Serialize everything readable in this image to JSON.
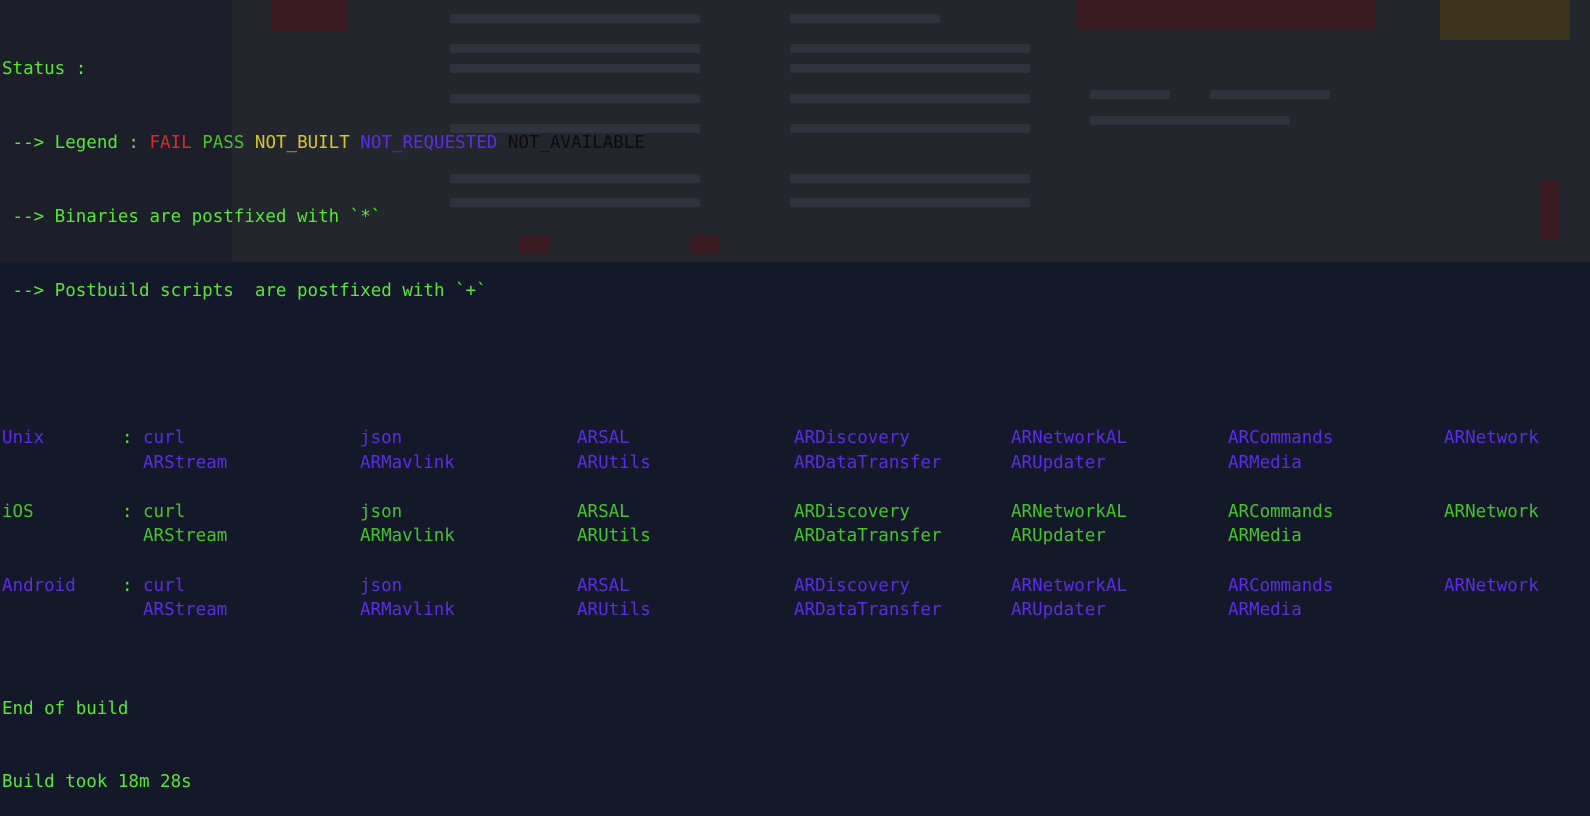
{
  "status": {
    "header": "Status :",
    "legend_prefix": " --> Legend : ",
    "legend": {
      "fail": "FAIL",
      "pass": "PASS",
      "not_built": "NOT_BUILT",
      "not_requested": "NOT_REQUESTED",
      "not_available": "NOT_AVAILABLE"
    },
    "binaries_note": " --> Binaries are postfixed with `*`",
    "postbuild_note": " --> Postbuild scripts  are postfixed with `+`"
  },
  "platforms": [
    {
      "name": "Unix",
      "state": "not_requested",
      "row1": [
        "curl",
        "json",
        "ARSAL",
        "ARDiscovery",
        "ARNetworkAL",
        "ARCommands",
        "ARNetwork"
      ],
      "row2": [
        "ARStream",
        "ARMavlink",
        "ARUtils",
        "ARDataTransfer",
        "ARUpdater",
        "ARMedia"
      ]
    },
    {
      "name": "iOS",
      "state": "pass",
      "row1": [
        "curl",
        "json",
        "ARSAL",
        "ARDiscovery",
        "ARNetworkAL",
        "ARCommands",
        "ARNetwork"
      ],
      "row2": [
        "ARStream",
        "ARMavlink",
        "ARUtils",
        "ARDataTransfer",
        "ARUpdater",
        "ARMedia"
      ]
    },
    {
      "name": "Android",
      "state": "not_requested",
      "row1": [
        "curl",
        "json",
        "ARSAL",
        "ARDiscovery",
        "ARNetworkAL",
        "ARCommands",
        "ARNetwork"
      ],
      "row2": [
        "ARStream",
        "ARMavlink",
        "ARUtils",
        "ARDataTransfer",
        "ARUpdater",
        "ARMedia"
      ]
    }
  ],
  "colon": ":",
  "footer": {
    "end": "End of build",
    "duration": "Build took 18m 28s"
  },
  "colors": {
    "background": "#15182a",
    "default_text": "#56e834",
    "fail": "#d12f2f",
    "pass": "#46c42a",
    "not_built": "#d6c62a",
    "not_requested": "#5a2ee6",
    "not_available": "#0b0b10"
  }
}
